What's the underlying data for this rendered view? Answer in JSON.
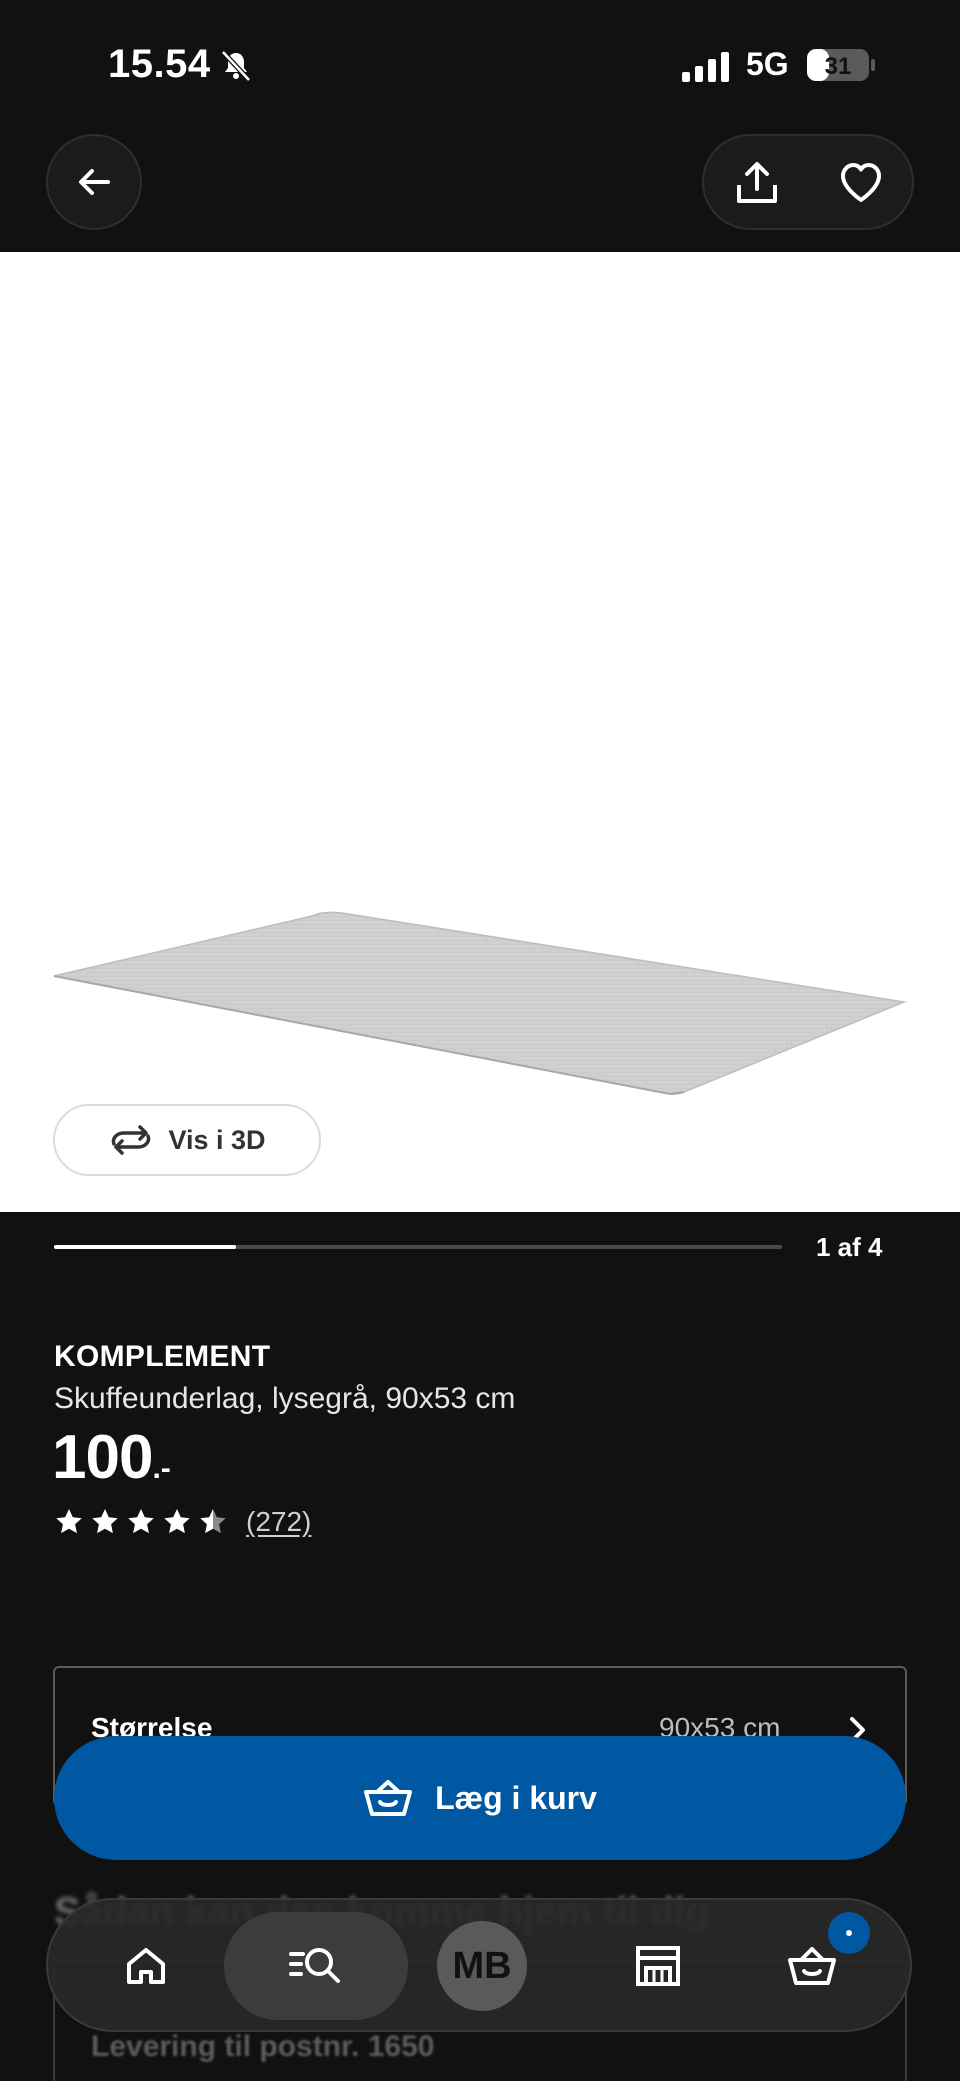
{
  "status_bar": {
    "time": "15.54",
    "network": "5G",
    "battery": "31"
  },
  "nav": {
    "back_icon": "arrow-left-icon",
    "share_icon": "share-icon",
    "favorite_icon": "heart-icon"
  },
  "gallery": {
    "view_3d_label": "Vis i 3D",
    "page_indicator": "1 af 4",
    "progress": 0.25
  },
  "product": {
    "name": "KOMPLEMENT",
    "description": "Skuffeunderlag, lysegrå, 90x53 cm",
    "price": "100",
    "price_suffix": ".-",
    "rating": 4.5,
    "review_count": "(272)"
  },
  "size_selector": {
    "label": "Størrelse",
    "value": "90x53 cm"
  },
  "add_to_cart": {
    "label": "Læg i kurv"
  },
  "underlying": {
    "blurred_heading": "Sådan kan den komme hjem til dig",
    "delivery": "Levering til postnr. 1650"
  },
  "tabbar": {
    "avatar_initials": "MB",
    "items": [
      "home-icon",
      "search-icon",
      "profile-avatar",
      "store-icon",
      "basket-icon"
    ]
  },
  "colors": {
    "background": "#111111",
    "accent_blue": "#0058a3",
    "image_bg": "#ffffff"
  }
}
